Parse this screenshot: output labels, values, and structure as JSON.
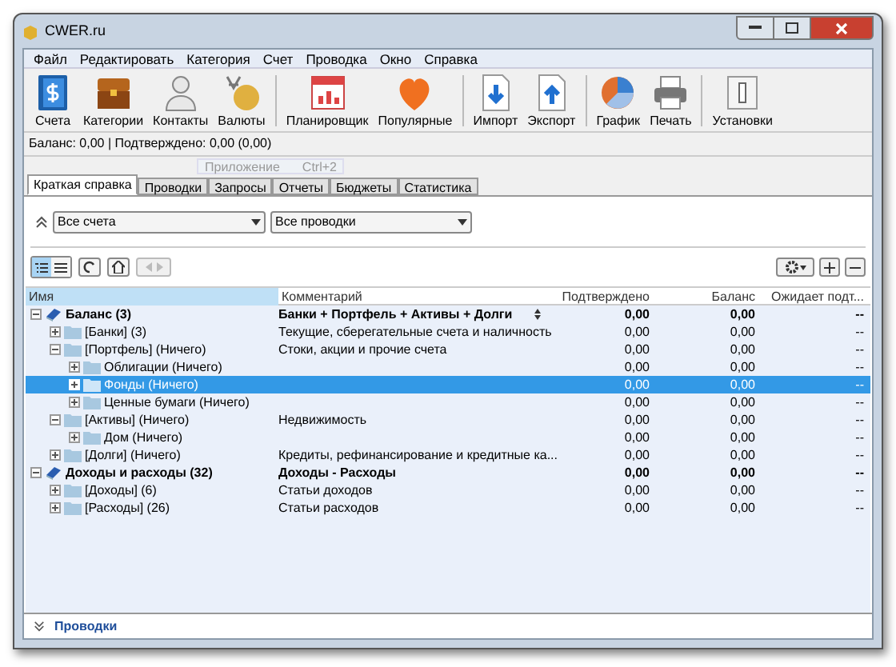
{
  "window": {
    "title": "CWER.ru"
  },
  "menu": [
    "Файл",
    "Редактировать",
    "Категория",
    "Счет",
    "Проводка",
    "Окно",
    "Справка"
  ],
  "toolbar": [
    [
      {
        "label": "Счета",
        "kind": "accounts"
      },
      {
        "label": "Категории",
        "kind": "categories"
      },
      {
        "label": "Контакты",
        "kind": "contacts"
      },
      {
        "label": "Валюты",
        "kind": "currencies"
      }
    ],
    [
      {
        "label": "Планировщик",
        "kind": "scheduler"
      },
      {
        "label": "Популярные",
        "kind": "favorites"
      }
    ],
    [
      {
        "label": "Импорт",
        "kind": "import"
      },
      {
        "label": "Экспорт",
        "kind": "export"
      }
    ],
    [
      {
        "label": "График",
        "kind": "chart"
      },
      {
        "label": "Печать",
        "kind": "print"
      }
    ],
    [
      {
        "label": "Установки",
        "kind": "settings"
      }
    ]
  ],
  "status": "Баланс: 0,00 | Подтверждено: 0,00 (0,00)",
  "tooltip": {
    "label": "Приложение",
    "shortcut": "Ctrl+2"
  },
  "tabs": [
    {
      "label": "Краткая справка",
      "selected": true
    },
    {
      "label": "Проводки",
      "selected": false
    },
    {
      "label": "Запросы",
      "selected": false
    },
    {
      "label": "Отчеты",
      "selected": false
    },
    {
      "label": "Бюджеты",
      "selected": false
    },
    {
      "label": "Статистика",
      "selected": false
    }
  ],
  "filters": {
    "accounts": "Все счета",
    "transactions": "Все проводки"
  },
  "view_modes": [
    {
      "kind": "tree",
      "selected": true
    },
    {
      "kind": "list",
      "selected": false
    }
  ],
  "table": {
    "columns": [
      "Имя",
      "Комментарий",
      "Подтверждено",
      "Баланс",
      "Ожидает подт..."
    ],
    "rows": [
      {
        "kind": "total",
        "name": "Баланс (3)",
        "comment": "Банки + Портфель + Активы + Долги",
        "confirmed": "0,00",
        "balance": "0,00",
        "pending": "--",
        "expanded": true,
        "selected": false,
        "children": [
          {
            "kind": "folder",
            "name": "[Банки] (3)",
            "comment": "Текущие, сберегательные счета и наличность",
            "confirmed": "0,00",
            "balance": "0,00",
            "pending": "--",
            "expanded": false,
            "selected": false
          },
          {
            "kind": "folder",
            "name": "[Портфель] (Ничего)",
            "comment": "Стоки, акции и прочие счета",
            "confirmed": "0,00",
            "balance": "0,00",
            "pending": "--",
            "expanded": true,
            "selected": false,
            "children": [
              {
                "kind": "folder",
                "name": "Облигации (Ничего)",
                "confirmed": "0,00",
                "balance": "0,00",
                "pending": "--",
                "expanded": false,
                "selected": false
              },
              {
                "kind": "folder",
                "name": "Фонды (Ничего)",
                "confirmed": "0,00",
                "balance": "0,00",
                "pending": "--",
                "expanded": false,
                "selected": true
              },
              {
                "kind": "folder",
                "name": "Ценные бумаги (Ничего)",
                "confirmed": "0,00",
                "balance": "0,00",
                "pending": "--",
                "expanded": false,
                "selected": false
              }
            ]
          },
          {
            "kind": "folder",
            "name": "[Активы] (Ничего)",
            "comment": "Недвижимость",
            "confirmed": "0,00",
            "balance": "0,00",
            "pending": "--",
            "expanded": true,
            "selected": false,
            "children": [
              {
                "kind": "folder",
                "name": "Дом (Ничего)",
                "confirmed": "0,00",
                "balance": "0,00",
                "pending": "--",
                "expanded": false,
                "selected": false
              }
            ]
          },
          {
            "kind": "folder",
            "name": "[Долги] (Ничего)",
            "comment": "Кредиты, рефинансирование и кредитные ка...",
            "confirmed": "0,00",
            "balance": "0,00",
            "pending": "--",
            "expanded": false,
            "selected": false
          }
        ]
      },
      {
        "kind": "total",
        "name": "Доходы и расходы (32)",
        "comment": "Доходы - Расходы",
        "confirmed": "0,00",
        "balance": "0,00",
        "pending": "--",
        "expanded": true,
        "selected": false,
        "children": [
          {
            "kind": "folder",
            "name": "[Доходы] (6)",
            "comment": "Статьи доходов",
            "confirmed": "0,00",
            "balance": "0,00",
            "pending": "--",
            "expanded": false,
            "selected": false
          },
          {
            "kind": "folder",
            "name": "[Расходы] (26)",
            "comment": "Статьи расходов",
            "confirmed": "0,00",
            "balance": "0,00",
            "pending": "--",
            "expanded": false,
            "selected": false
          }
        ]
      }
    ]
  },
  "bottom_panel": {
    "label": "Проводки"
  }
}
